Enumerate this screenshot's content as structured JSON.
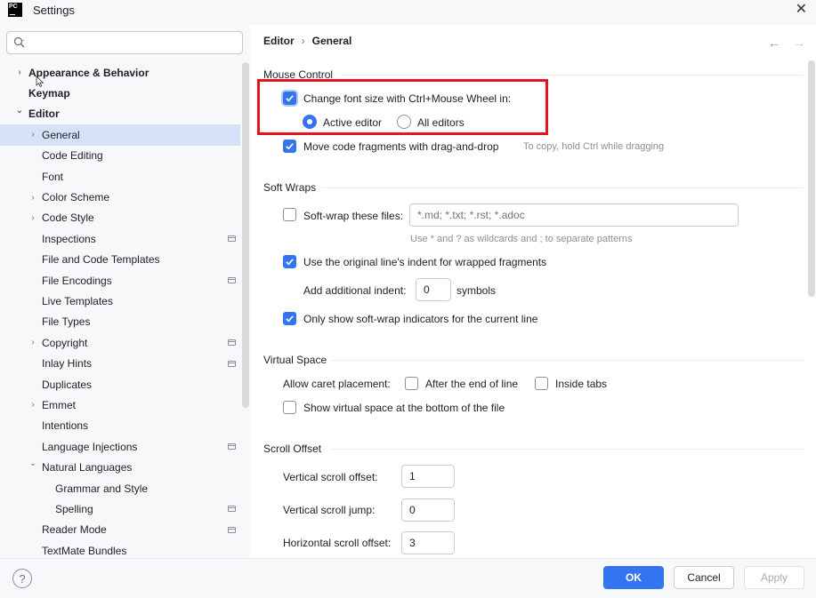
{
  "window": {
    "title": "Settings",
    "app_icon_text": "PC"
  },
  "search": {
    "placeholder": ""
  },
  "sidebar": {
    "items": [
      {
        "label": "Appearance & Behavior",
        "level": 0,
        "arrow": "right",
        "bold": true
      },
      {
        "label": "Keymap",
        "level": 0,
        "arrow": "",
        "bold": true
      },
      {
        "label": "Editor",
        "level": 0,
        "arrow": "down",
        "bold": true
      },
      {
        "label": "General",
        "level": 1,
        "arrow": "right",
        "selected": true
      },
      {
        "label": "Code Editing",
        "level": 1,
        "arrow": ""
      },
      {
        "label": "Font",
        "level": 1,
        "arrow": ""
      },
      {
        "label": "Color Scheme",
        "level": 1,
        "arrow": "right"
      },
      {
        "label": "Code Style",
        "level": 1,
        "arrow": "right"
      },
      {
        "label": "Inspections",
        "level": 1,
        "arrow": "",
        "project": true
      },
      {
        "label": "File and Code Templates",
        "level": 1,
        "arrow": ""
      },
      {
        "label": "File Encodings",
        "level": 1,
        "arrow": "",
        "project": true
      },
      {
        "label": "Live Templates",
        "level": 1,
        "arrow": ""
      },
      {
        "label": "File Types",
        "level": 1,
        "arrow": ""
      },
      {
        "label": "Copyright",
        "level": 1,
        "arrow": "right",
        "project": true
      },
      {
        "label": "Inlay Hints",
        "level": 1,
        "arrow": "",
        "project": true
      },
      {
        "label": "Duplicates",
        "level": 1,
        "arrow": ""
      },
      {
        "label": "Emmet",
        "level": 1,
        "arrow": "right"
      },
      {
        "label": "Intentions",
        "level": 1,
        "arrow": ""
      },
      {
        "label": "Language Injections",
        "level": 1,
        "arrow": "",
        "project": true
      },
      {
        "label": "Natural Languages",
        "level": 1,
        "arrow": "down"
      },
      {
        "label": "Grammar and Style",
        "level": 2,
        "arrow": ""
      },
      {
        "label": "Spelling",
        "level": 2,
        "arrow": "",
        "project": true
      },
      {
        "label": "Reader Mode",
        "level": 1,
        "arrow": "",
        "project": true
      },
      {
        "label": "TextMate Bundles",
        "level": 1,
        "arrow": ""
      }
    ]
  },
  "breadcrumb": {
    "parent": "Editor",
    "separator": "›",
    "current": "General"
  },
  "nav": {
    "back": "←",
    "forward": "→"
  },
  "mouse_control": {
    "title": "Mouse Control",
    "change_font_label": "Change font size with Ctrl+Mouse Wheel in:",
    "change_font_checked": true,
    "radio_active": "Active editor",
    "radio_all": "All editors",
    "selected_radio": "Active editor",
    "drag_drop_label": "Move code fragments with drag-and-drop",
    "drag_drop_checked": true,
    "drag_drop_hint": "To copy, hold Ctrl while dragging"
  },
  "soft_wraps": {
    "title": "Soft Wraps",
    "wrap_files_label": "Soft-wrap these files:",
    "wrap_files_checked": false,
    "wrap_files_placeholder": "*.md; *.txt; *.rst; *.adoc",
    "wrap_files_hint": "Use * and ? as wildcards and ; to separate patterns",
    "original_indent_label": "Use the original line's indent for wrapped fragments",
    "original_indent_checked": true,
    "additional_indent_label": "Add additional indent:",
    "additional_indent_value": "0",
    "additional_indent_unit": "symbols",
    "current_line_label": "Only show soft-wrap indicators for the current line",
    "current_line_checked": true
  },
  "virtual_space": {
    "title": "Virtual Space",
    "caret_label": "Allow caret placement:",
    "after_end_label": "After the end of line",
    "after_end_checked": false,
    "inside_tabs_label": "Inside tabs",
    "inside_tabs_checked": false,
    "bottom_label": "Show virtual space at the bottom of the file",
    "bottom_checked": false
  },
  "scroll_offset": {
    "title": "Scroll Offset",
    "vertical_offset_label": "Vertical scroll offset:",
    "vertical_offset_value": "1",
    "vertical_jump_label": "Vertical scroll jump:",
    "vertical_jump_value": "0",
    "horizontal_offset_label": "Horizontal scroll offset:",
    "horizontal_offset_value": "3"
  },
  "footer": {
    "help": "?",
    "ok": "OK",
    "cancel": "Cancel",
    "apply": "Apply"
  },
  "colors": {
    "accent": "#3574f0",
    "selection": "#d5e1f7",
    "highlight_border": "#e8141c"
  }
}
